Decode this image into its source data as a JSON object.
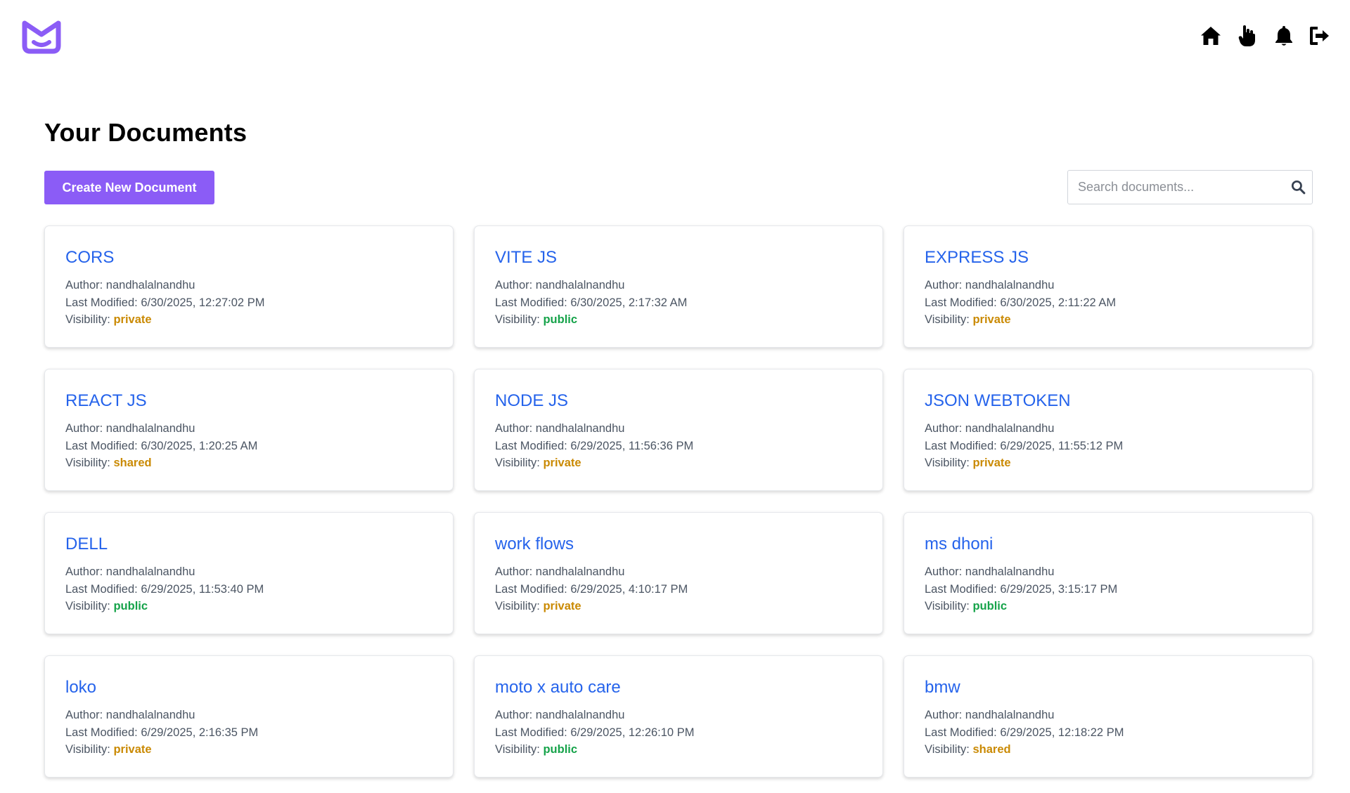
{
  "header": {
    "nav": [
      {
        "name": "home",
        "icon": "home-icon"
      },
      {
        "name": "documents",
        "icon": "hand-pointer-icon"
      },
      {
        "name": "notifications",
        "icon": "bell-icon"
      },
      {
        "name": "logout",
        "icon": "logout-icon"
      }
    ]
  },
  "page": {
    "title": "Your Documents",
    "create_label": "Create New Document",
    "search_placeholder": "Search documents...",
    "author_label": "Author: ",
    "modified_label": "Last Modified: ",
    "visibility_label": "Visibility: "
  },
  "colors": {
    "brand": "#8b5cf6",
    "link": "#2563eb",
    "private": "#ca8a04",
    "shared": "#ca8a04",
    "public": "#16a34a"
  },
  "documents": [
    {
      "title": "CORS",
      "author": "nandhalalnandhu",
      "modified": "6/30/2025, 12:27:02 PM",
      "visibility": "private"
    },
    {
      "title": "VITE JS",
      "author": "nandhalalnandhu",
      "modified": "6/30/2025, 2:17:32 AM",
      "visibility": "public"
    },
    {
      "title": "EXPRESS JS",
      "author": "nandhalalnandhu",
      "modified": "6/30/2025, 2:11:22 AM",
      "visibility": "private"
    },
    {
      "title": "REACT JS",
      "author": "nandhalalnandhu",
      "modified": "6/30/2025, 1:20:25 AM",
      "visibility": "shared"
    },
    {
      "title": "NODE JS",
      "author": "nandhalalnandhu",
      "modified": "6/29/2025, 11:56:36 PM",
      "visibility": "private"
    },
    {
      "title": "JSON WEBTOKEN",
      "author": "nandhalalnandhu",
      "modified": "6/29/2025, 11:55:12 PM",
      "visibility": "private"
    },
    {
      "title": "DELL",
      "author": "nandhalalnandhu",
      "modified": "6/29/2025, 11:53:40 PM",
      "visibility": "public"
    },
    {
      "title": "work flows",
      "author": "nandhalalnandhu",
      "modified": "6/29/2025, 4:10:17 PM",
      "visibility": "private"
    },
    {
      "title": "ms dhoni",
      "author": "nandhalalnandhu",
      "modified": "6/29/2025, 3:15:17 PM",
      "visibility": "public"
    },
    {
      "title": "loko",
      "author": "nandhalalnandhu",
      "modified": "6/29/2025, 2:16:35 PM",
      "visibility": "private"
    },
    {
      "title": "moto x auto care",
      "author": "nandhalalnandhu",
      "modified": "6/29/2025, 12:26:10 PM",
      "visibility": "public"
    },
    {
      "title": "bmw",
      "author": "nandhalalnandhu",
      "modified": "6/29/2025, 12:18:22 PM",
      "visibility": "shared"
    }
  ]
}
